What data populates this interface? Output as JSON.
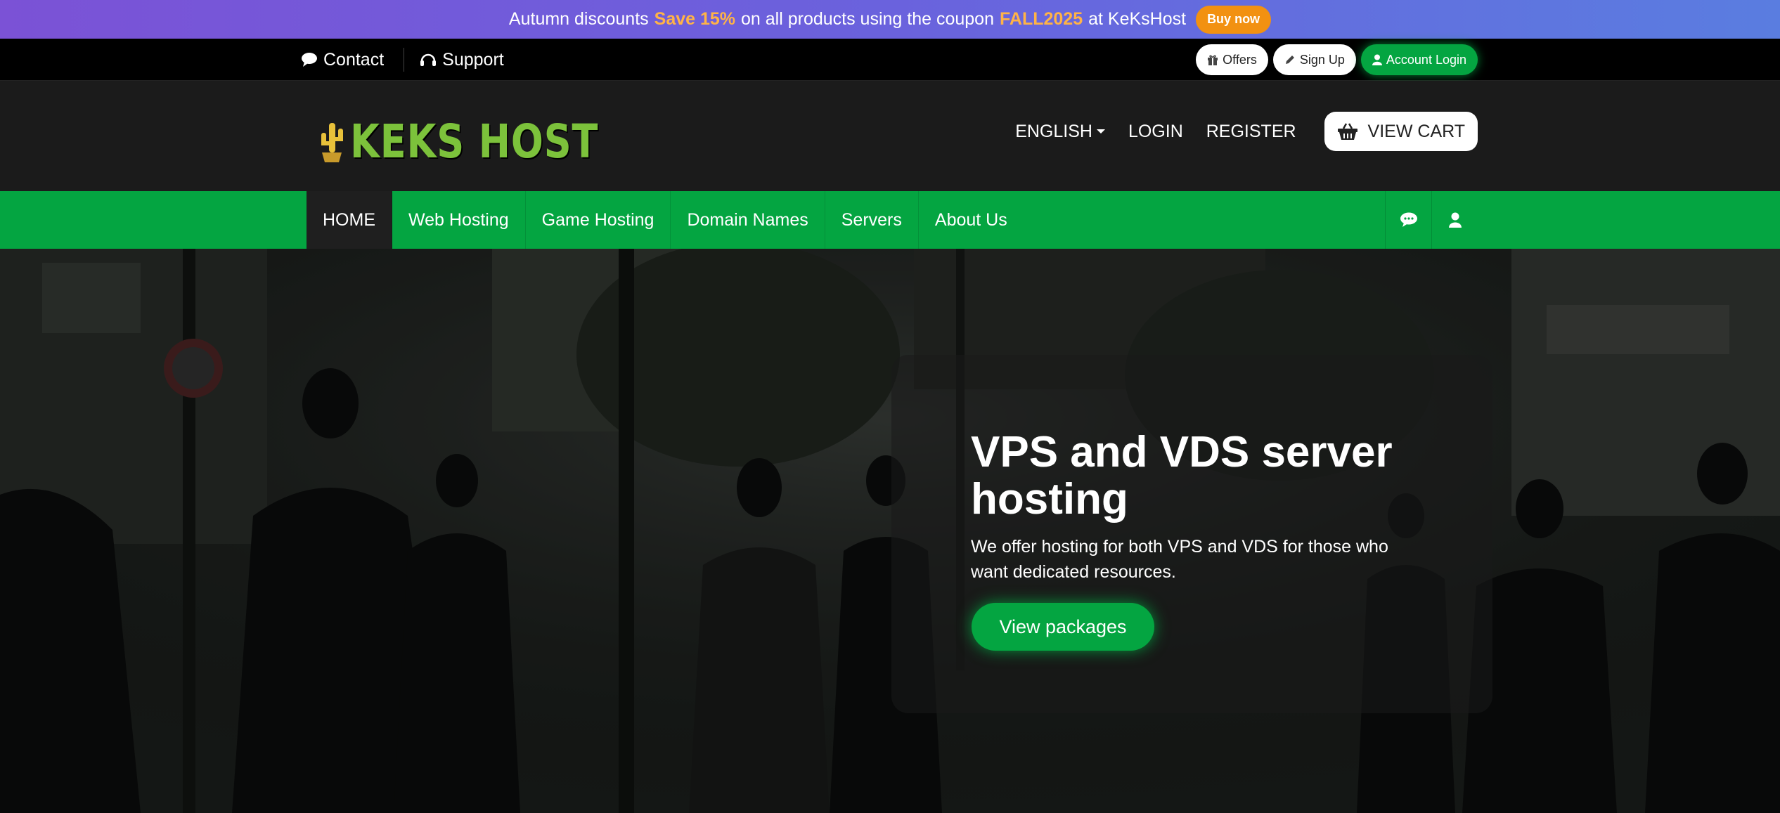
{
  "promo": {
    "text1": "Autumn discounts",
    "highlight1": "Save 15%",
    "text2": "on all products using the coupon",
    "coupon": "FALL2025",
    "text3": "at KeKsHost",
    "button": "Buy now",
    "button_color": "#f29111"
  },
  "topbar": {
    "contact": "Contact",
    "support": "Support",
    "offers": "Offers",
    "signup": "Sign Up",
    "account_login": "Account Login"
  },
  "header": {
    "logo_text": "KEKS HOST",
    "language": "ENGLISH",
    "login": "LOGIN",
    "register": "REGISTER",
    "cart": "VIEW CART"
  },
  "nav": {
    "items": [
      "HOME",
      "Web Hosting",
      "Game Hosting",
      "Domain Names",
      "Servers",
      "About Us"
    ],
    "active": "HOME",
    "icons": [
      "chat-icon",
      "user-icon"
    ]
  },
  "hero": {
    "title": "VPS and VDS server hosting",
    "subtitle": "We offer hosting for both VPS and VDS for those who want dedicated resources.",
    "cta": "View packages"
  },
  "colors": {
    "accent_green": "#04a541",
    "logo_green": "#7cc23b",
    "promo_gradient_start": "#7b52d6",
    "promo_gradient_end": "#5a7de0",
    "highlight_orange": "#ffb347"
  }
}
